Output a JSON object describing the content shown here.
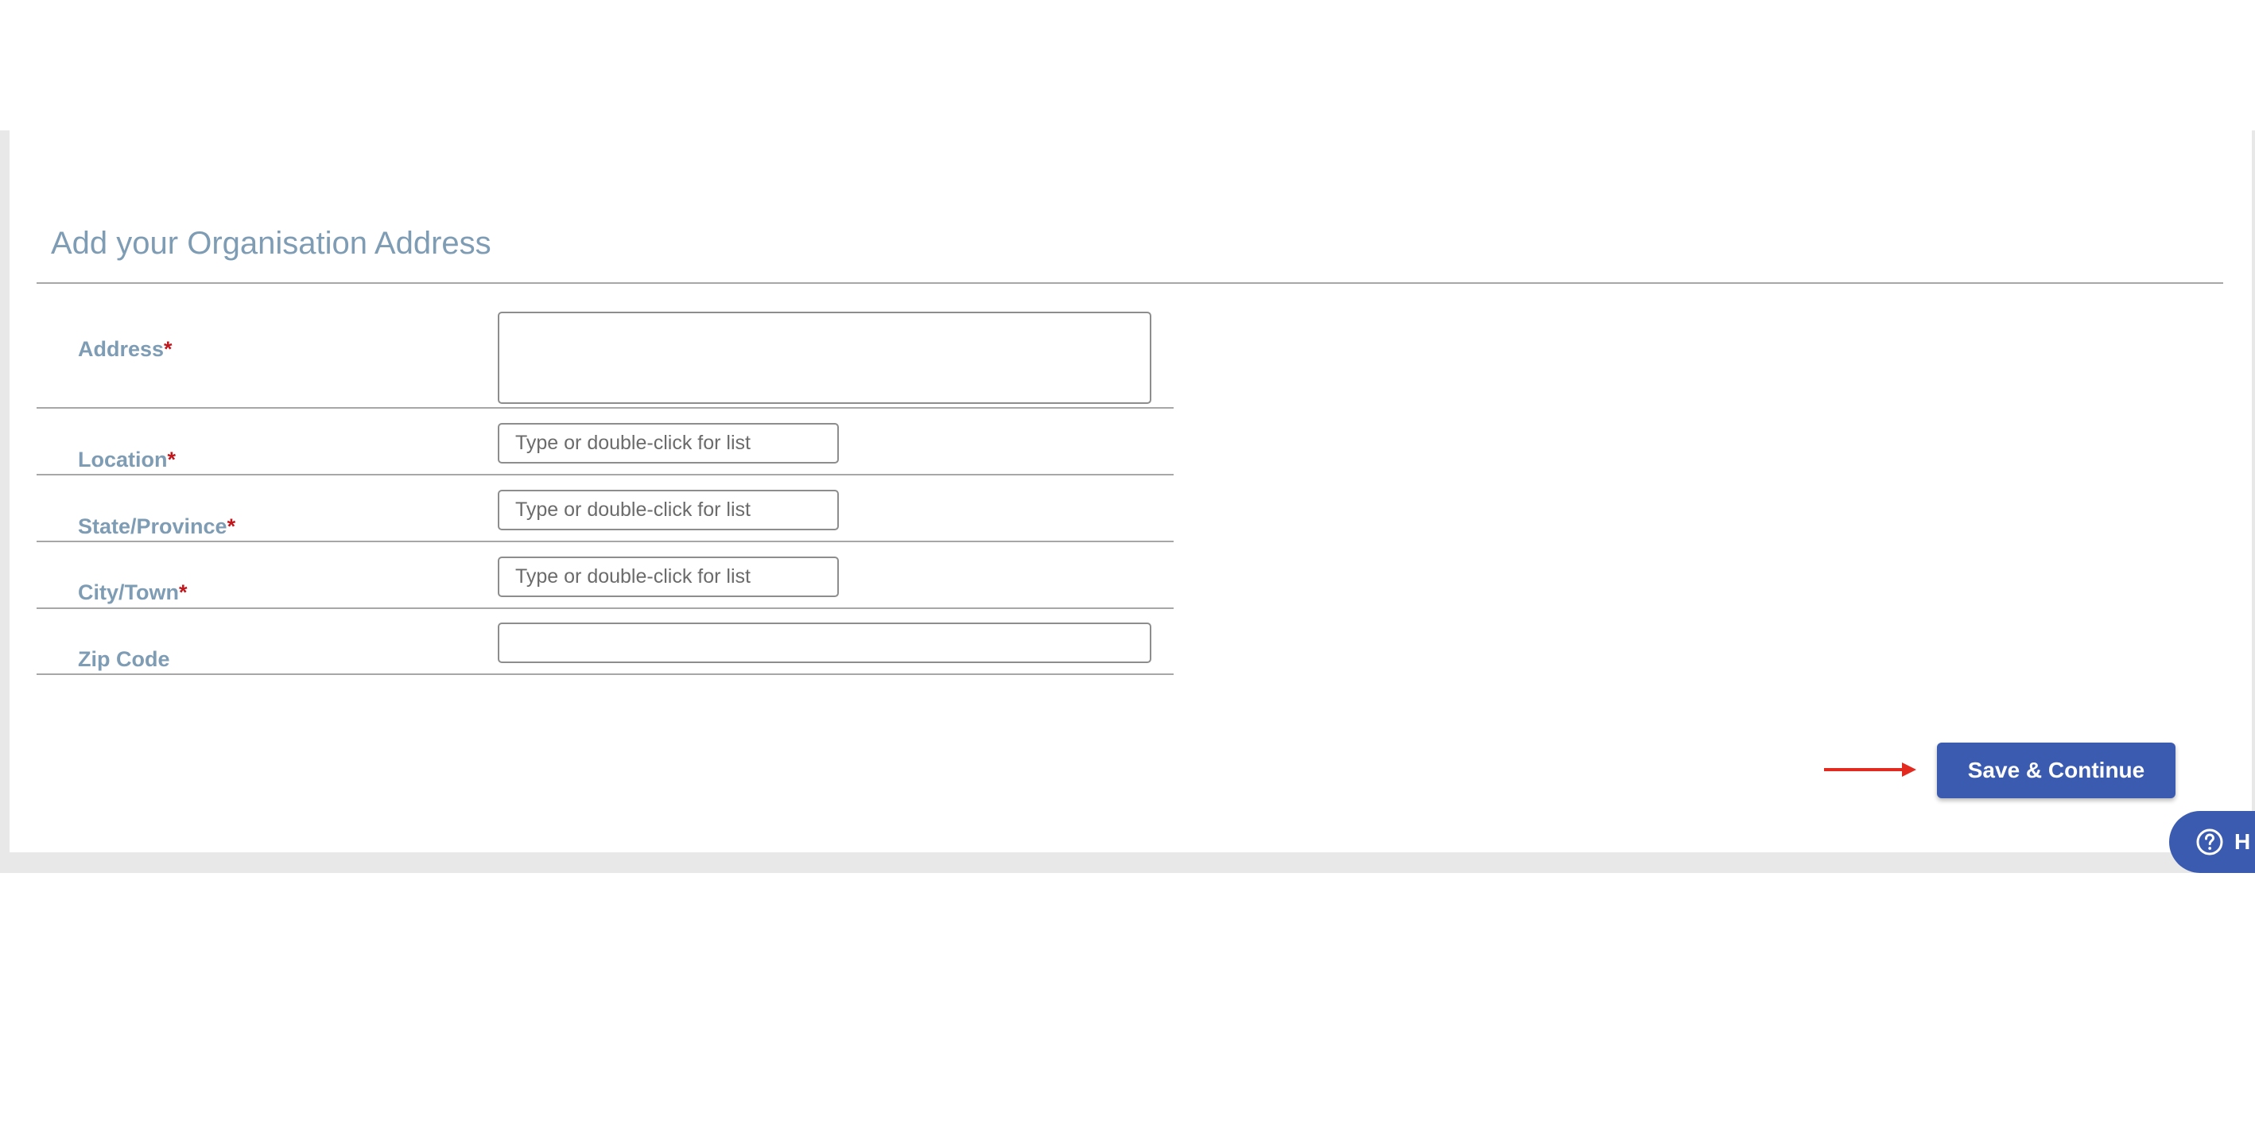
{
  "form": {
    "title": "Add your Organisation Address",
    "required_marker": "*",
    "address": {
      "label": "Address",
      "value": "",
      "placeholder": ""
    },
    "location": {
      "label": "Location",
      "value": "",
      "placeholder": "Type or double-click for list"
    },
    "state": {
      "label": "State/Province",
      "value": "",
      "placeholder": "Type or double-click for list"
    },
    "city": {
      "label": "City/Town",
      "value": "",
      "placeholder": "Type or double-click for list"
    },
    "zip": {
      "label": "Zip Code",
      "value": "",
      "placeholder": ""
    }
  },
  "actions": {
    "save_label": "Save & Continue"
  },
  "help": {
    "label": "H"
  },
  "icons": {
    "arrow": "arrow-right-icon",
    "help": "question-circle-icon"
  },
  "colors": {
    "accent": "#3a5bb0",
    "label": "#7e9cb4",
    "required": "#c0161c",
    "annotation_arrow": "#e22a20"
  }
}
